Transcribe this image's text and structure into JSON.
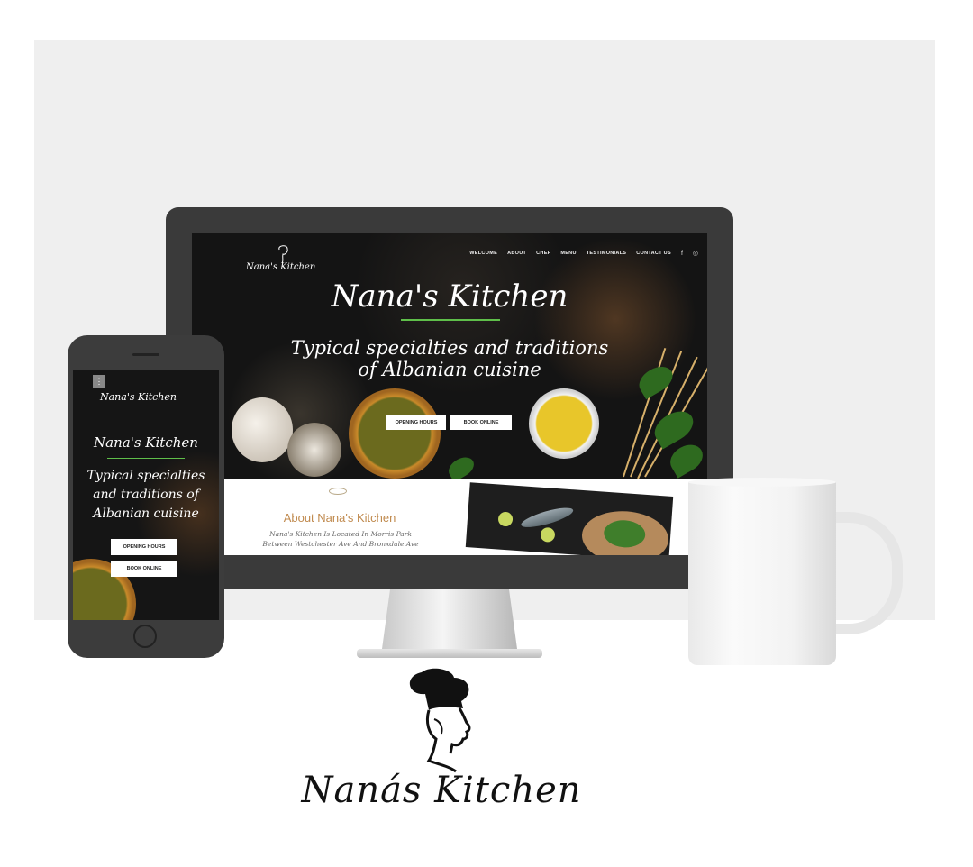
{
  "desktop": {
    "logo_text": "Nana's Kitchen",
    "nav": [
      "WELCOME",
      "ABOUT",
      "CHEF",
      "MENU",
      "TESTIMONIALS",
      "CONTACT US"
    ],
    "social_icons": [
      "facebook-icon",
      "instagram-icon"
    ],
    "hero_title": "Nana's Kitchen",
    "hero_subtitle_line1": "Typical specialties and traditions",
    "hero_subtitle_line2": "of Albanian cuisine",
    "buttons": {
      "opening_hours": "OPENING HOURS",
      "book_online": "BOOK ONLINE"
    },
    "about": {
      "title": "About Nana's Kitchen",
      "text_line1": "Nana's Kitchen Is Located In Morris Park",
      "text_line2": "Between Westchester Ave And Bronxdale Ave"
    }
  },
  "mobile": {
    "menu_icon": "kebab-menu-icon",
    "logo_text": "Nana's Kitchen",
    "hero_title": "Nana's Kitchen",
    "hero_subtitle_line1": "Typical specialties",
    "hero_subtitle_line2": "and traditions of",
    "hero_subtitle_line3": "Albanian cuisine",
    "buttons": {
      "opening_hours": "OPENING HOURS",
      "book_online": "BOOK ONLINE"
    }
  },
  "brand_logo": {
    "text": "Nanás Kitchen",
    "icon": "chef-silhouette-icon"
  },
  "colors": {
    "accent_green": "#5fbf4a",
    "about_title": "#c08a4e",
    "screen_bg": "#141414"
  }
}
